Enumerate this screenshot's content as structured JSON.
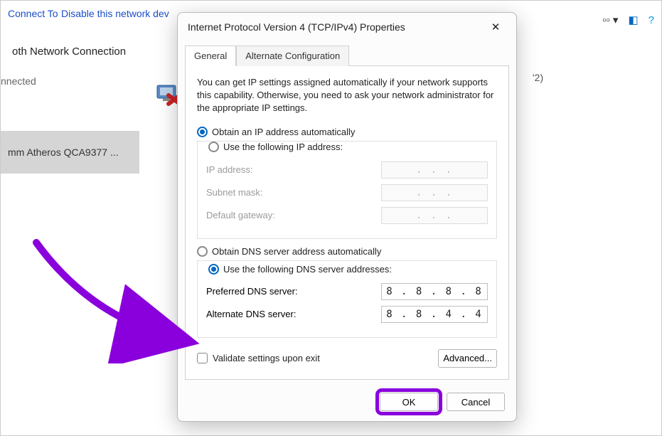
{
  "bg": {
    "connect_to": "Connect To",
    "disable": "Disable this network dev",
    "conn_name": "oth Network Connection",
    "conn_status": "nnected",
    "selected_adapter": "mm Atheros QCA9377 ...",
    "right_text": "'2)"
  },
  "dialog": {
    "title": "Internet Protocol Version 4 (TCP/IPv4) Properties",
    "tabs": {
      "general": "General",
      "alternate": "Alternate Configuration"
    },
    "desc": "You can get IP settings assigned automatically if your network supports this capability. Otherwise, you need to ask your network administrator for the appropriate IP settings.",
    "ip_auto": "Obtain an IP address automatically",
    "ip_manual": "Use the following IP address:",
    "ip_address_label": "IP address:",
    "subnet_label": "Subnet mask:",
    "gateway_label": "Default gateway:",
    "dns_auto": "Obtain DNS server address automatically",
    "dns_manual": "Use the following DNS server addresses:",
    "pref_dns_label": "Preferred DNS server:",
    "alt_dns_label": "Alternate DNS server:",
    "pref_dns_value": "8 . 8 . 8 . 8",
    "alt_dns_value": "8 . 8 . 4 . 4",
    "validate": "Validate settings upon exit",
    "advanced": "Advanced...",
    "ok": "OK",
    "cancel": "Cancel",
    "dots": ".       .       ."
  }
}
